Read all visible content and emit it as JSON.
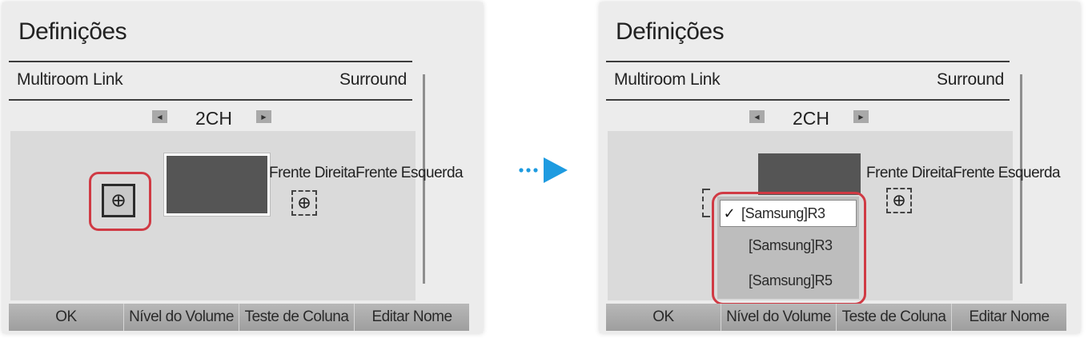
{
  "left": {
    "title": "Definições",
    "setting_name": "Multiroom Link",
    "setting_value": "Surround",
    "channel": "2CH",
    "speaker_label": "Frente DireitaFrente Esquerda",
    "buttons": [
      "OK",
      "Nível do Volume",
      "Teste de Coluna",
      "Editar Nome"
    ]
  },
  "right": {
    "title": "Definições",
    "setting_name": "Multiroom Link",
    "setting_value": "Surround",
    "channel": "2CH",
    "speaker_label": "Frente DireitaFrente Esquerda",
    "dropdown": {
      "items": [
        {
          "label": "[Samsung]R3",
          "checked": true
        },
        {
          "label": "[Samsung]R3",
          "checked": false
        },
        {
          "label": "[Samsung]R5",
          "checked": false
        }
      ],
      "check_glyph": "✓"
    },
    "buttons": [
      "OK",
      "Nível do Volume",
      "Teste de Coluna",
      "Editar Nome"
    ]
  },
  "colors": {
    "highlight": "#d03a44",
    "arrow": "#1e9be0",
    "panel_bg": "#ececec",
    "speaker_box": "#555555"
  },
  "icons": {
    "speaker_add": "crosshair-circle-icon",
    "prev": "triangle-left-icon",
    "next": "triangle-right-icon",
    "transition": "arrow-right-icon"
  }
}
